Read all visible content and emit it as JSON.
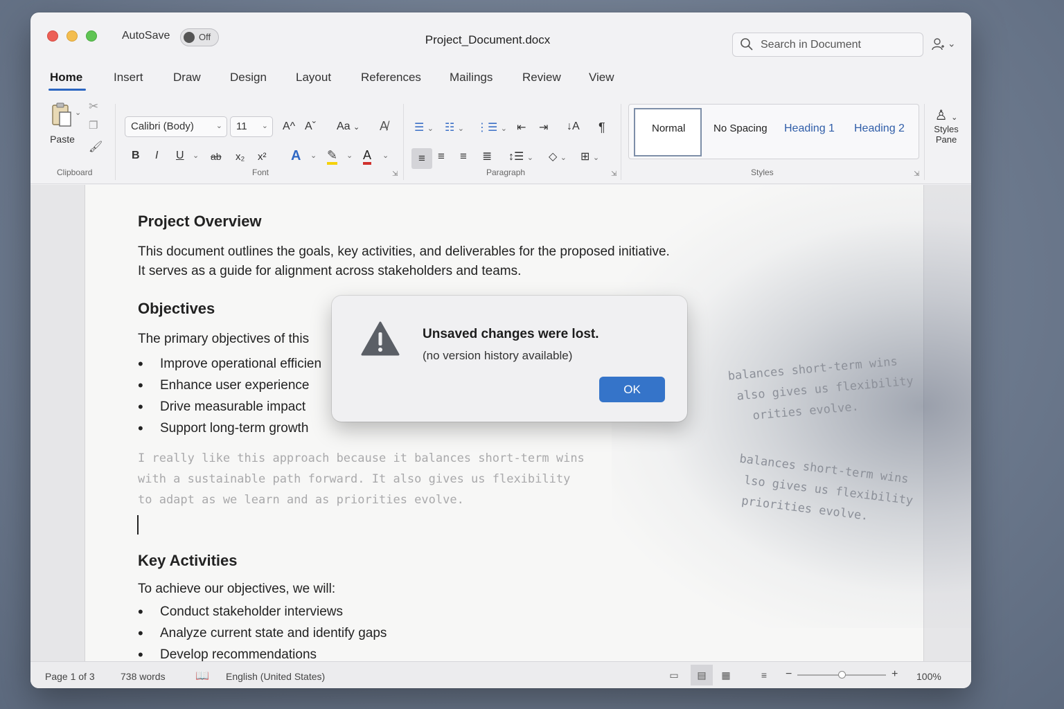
{
  "titlebar": {
    "autosave_label": "AutoSave",
    "autosave_state": "Off",
    "document_title": "Project_Document.docx",
    "search_placeholder": "Search in Document",
    "account_caret": "⌄"
  },
  "tabs": [
    "Home",
    "Insert",
    "Draw",
    "Design",
    "Layout",
    "References",
    "Mailings",
    "Review",
    "View"
  ],
  "ribbon": {
    "clipboard": {
      "paste_label": "Paste",
      "group_label": "Clipboard"
    },
    "font": {
      "font_name": "Calibri (Body)",
      "font_size": "11",
      "grow_label": "A^",
      "shrink_label": "Aˇ",
      "case_label": "Aa",
      "bold": "B",
      "italic": "I",
      "underline": "U",
      "strike": "ab",
      "subscript": "x₂",
      "superscript": "x²",
      "text_effects": "A",
      "highlight": "✎",
      "font_color": "A",
      "group_label": "Font"
    },
    "paragraph": {
      "group_label": "Paragraph",
      "pilcrow": "¶"
    },
    "styles": {
      "items": [
        "Normal",
        "No Spacing",
        "Heading 1",
        "Heading 2"
      ],
      "group_label": "Styles",
      "pane_label_1": "Styles",
      "pane_label_2": "Pane"
    }
  },
  "document": {
    "h1": "Project Overview",
    "p1_line1": "This document outlines the goals, key activities, and deliverables for the proposed initiative.",
    "p1_line2": "It serves as a guide for alignment across stakeholders and teams.",
    "h2": "Objectives",
    "p2": "The primary objectives of this",
    "objectives": [
      "Improve operational efficien",
      "Enhance user experience",
      "Drive measurable impact",
      "Support long-term growth"
    ],
    "faded_text": "I really like this approach because it balances short-term wins\nwith a sustainable path forward. It also gives us flexibility\nto adapt as we learn and as priorities evolve.",
    "dust_text_1": "balances short-term wins\n also gives us flexibility\n   orities evolve.",
    "dust_text_2": "balances short-term wins\n lso gives us flexibility\n priorities evolve.",
    "h3": "Key Activities",
    "p3": "To achieve our objectives, we will:",
    "activities": [
      "Conduct stakeholder interviews",
      "Analyze current state and identify gaps",
      "Develop recommendations"
    ]
  },
  "dialog": {
    "title": "Unsaved changes were lost.",
    "message": "(no version history available)",
    "ok_label": "OK"
  },
  "statusbar": {
    "page": "Page 1 of 3",
    "words": "738 words",
    "language": "English (United States)",
    "zoom_minus": "−",
    "zoom_plus": "+",
    "zoom": "100%"
  },
  "colors": {
    "accent": "#2b66c1",
    "ok_button": "#3574c9",
    "heading_style": "#2f5da8",
    "highlight": "#f5d10a",
    "font_color": "#d0312d"
  },
  "icons": [
    "search-icon",
    "account-icon",
    "paste-icon",
    "cut-icon",
    "copy-icon",
    "format-painter-icon",
    "warning-icon",
    "read-mode-icon",
    "print-layout-icon",
    "web-layout-icon",
    "focus-icon"
  ]
}
